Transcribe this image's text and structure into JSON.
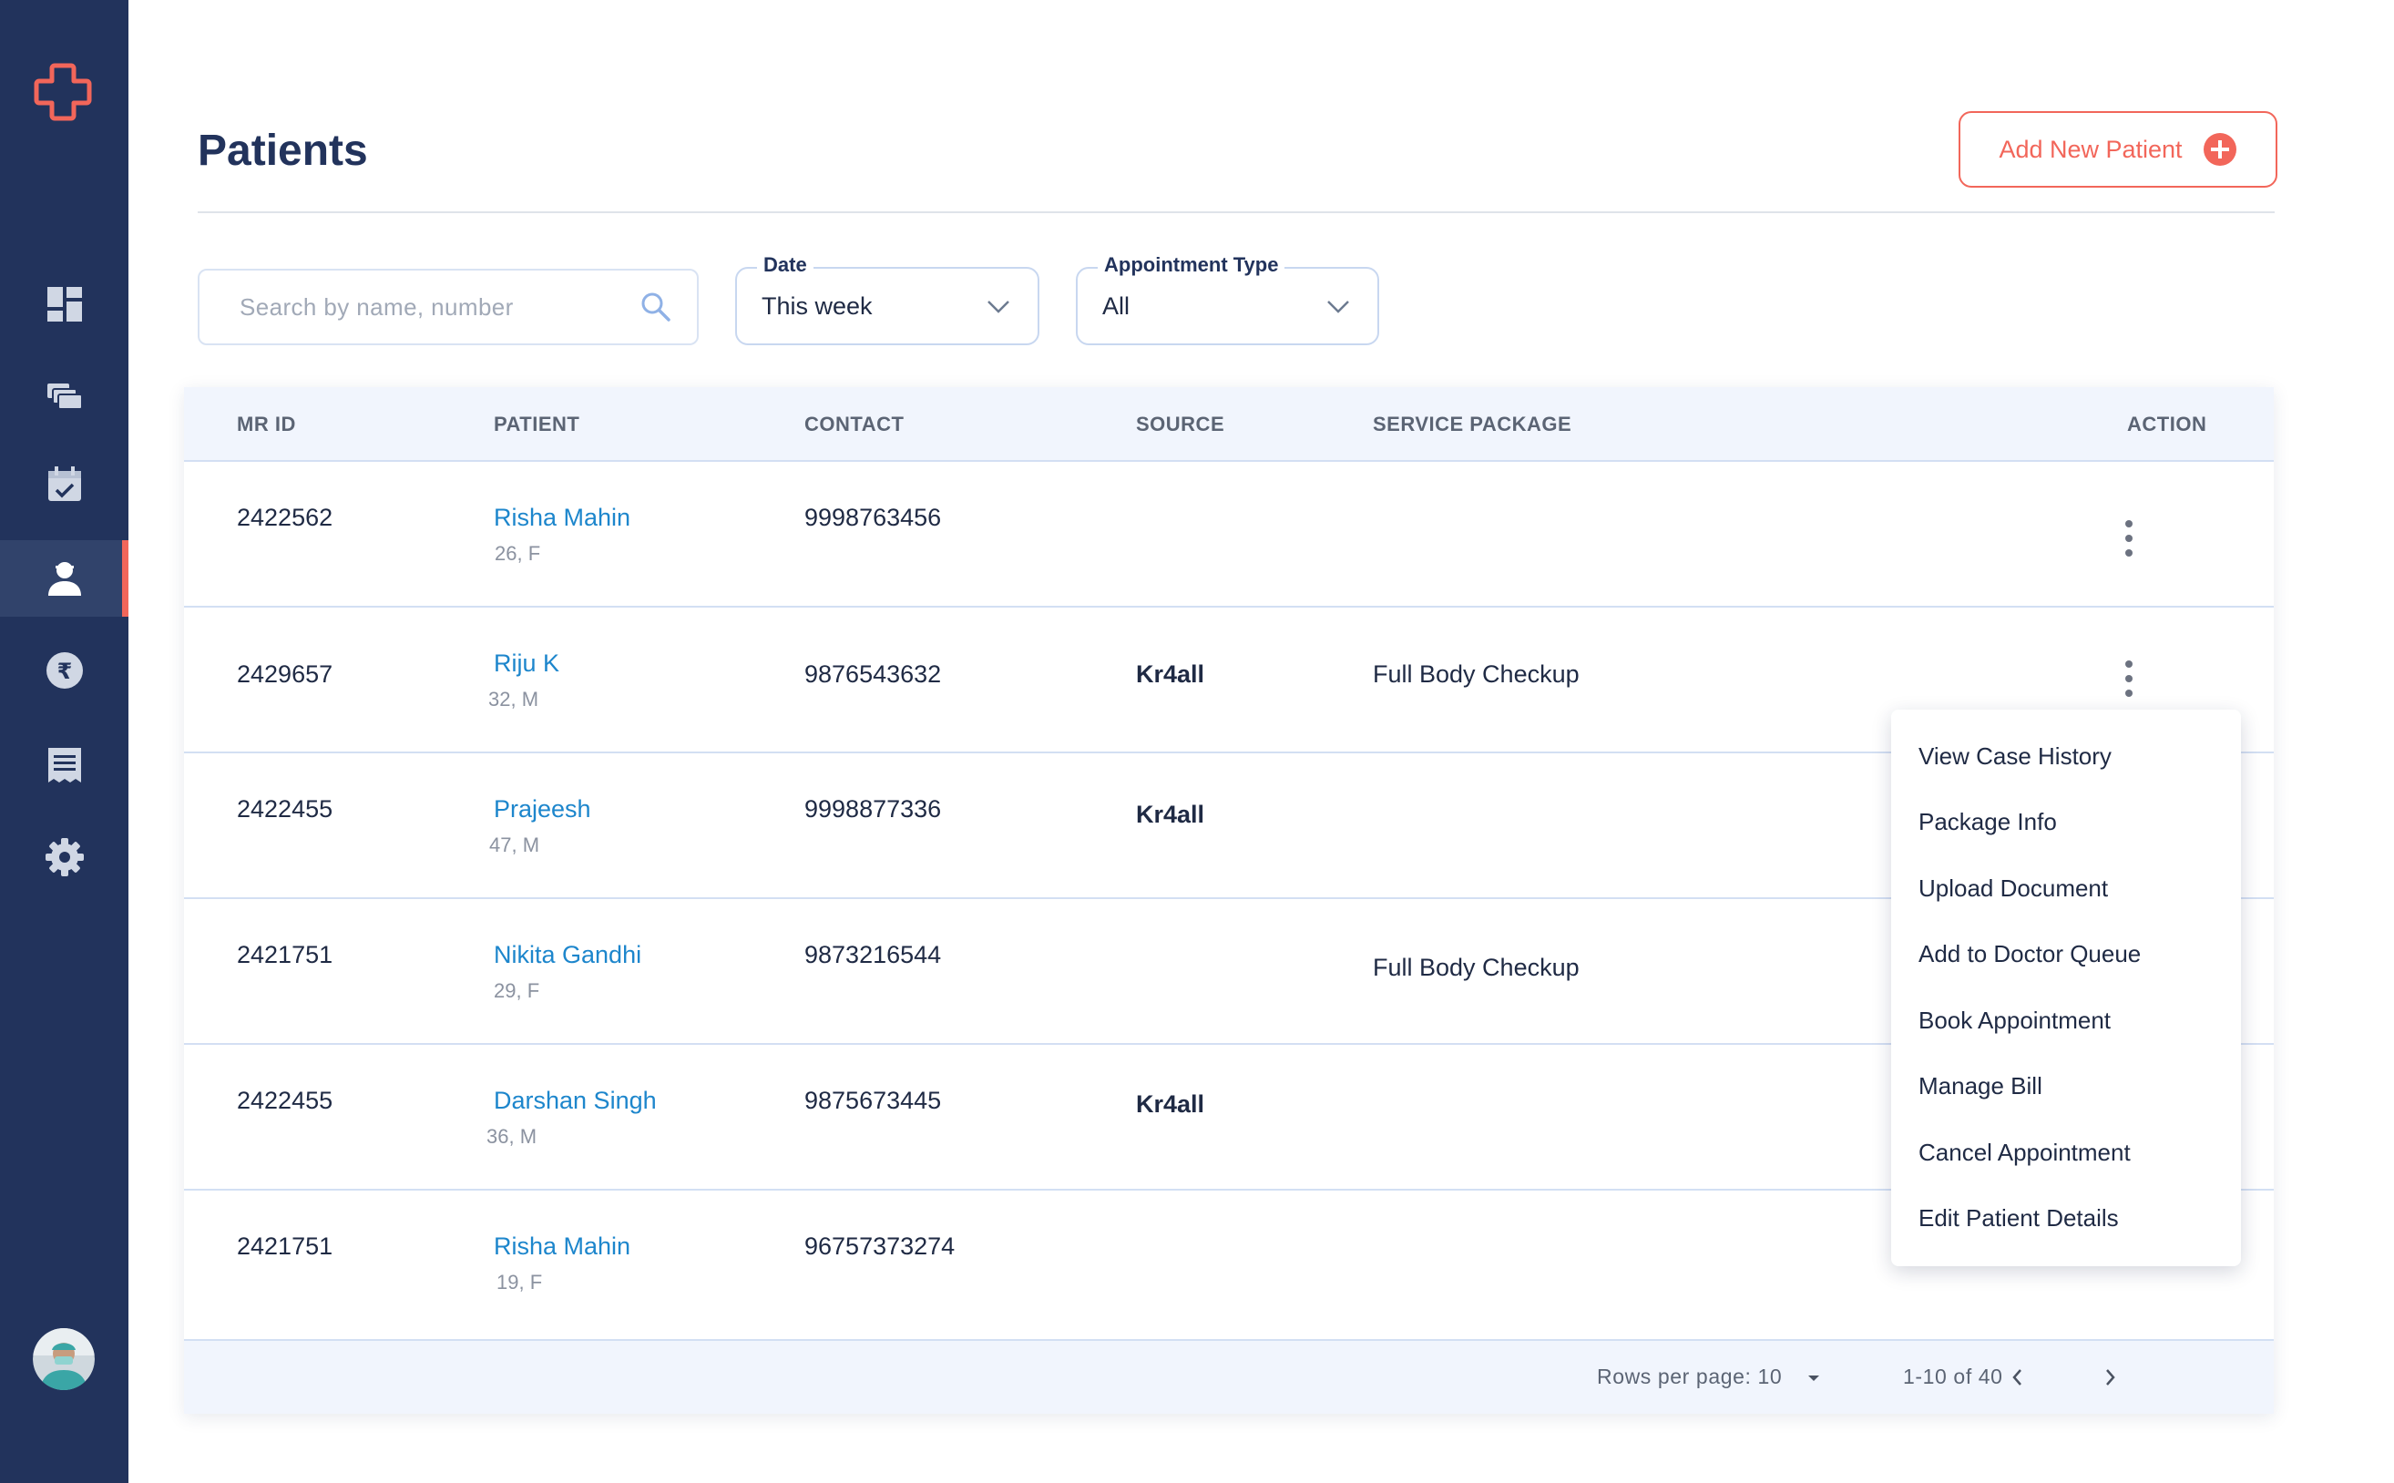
{
  "sidebar": {
    "items": [
      {
        "icon": "dashboard-icon"
      },
      {
        "icon": "patients-cards-icon"
      },
      {
        "icon": "calendar-check-icon"
      },
      {
        "icon": "patient-user-icon",
        "active": true
      },
      {
        "icon": "rupee-icon"
      },
      {
        "icon": "receipt-icon"
      },
      {
        "icon": "settings-gear-icon"
      }
    ],
    "avatar_icon": "doctor-avatar"
  },
  "header": {
    "title": "Patients",
    "add_button_label": "Add New Patient"
  },
  "filters": {
    "search_placeholder": "Search by name, number",
    "date_label": "Date",
    "date_value": "This week",
    "appointment_type_label": "Appointment Type",
    "appointment_type_value": "All"
  },
  "table": {
    "columns": [
      "MR ID",
      "PATIENT",
      "CONTACT",
      "SOURCE",
      "SERVICE PACKAGE",
      "ACTION"
    ],
    "rows": [
      {
        "mr_id": "2422562",
        "name": "Risha Mahin",
        "age_sex": "26, F",
        "contact": "9998763456",
        "source": "",
        "package": ""
      },
      {
        "mr_id": "2429657",
        "name": "Riju K",
        "age_sex": "32, M",
        "contact": "9876543632",
        "source": "Kr4all",
        "package": "Full Body Checkup"
      },
      {
        "mr_id": "2422455",
        "name": "Prajeesh",
        "age_sex": "47, M",
        "contact": "9998877336",
        "source": "Kr4all",
        "package": ""
      },
      {
        "mr_id": "2421751",
        "name": "Nikita Gandhi",
        "age_sex": "29, F",
        "contact": "9873216544",
        "source": "",
        "package": "Full Body Checkup"
      },
      {
        "mr_id": "2422455",
        "name": "Darshan Singh",
        "age_sex": "36, M",
        "contact": "9875673445",
        "source": "Kr4all",
        "package": ""
      },
      {
        "mr_id": "2421751",
        "name": "Risha Mahin",
        "age_sex": "19, F",
        "contact": "96757373274",
        "source": "",
        "package": ""
      }
    ],
    "footer": {
      "rows_per_page": "Rows per page: 10",
      "range": "1-10 of 40"
    }
  },
  "action_menu": {
    "items": [
      "View Case History",
      "Package Info",
      "Upload Document",
      "Add to Doctor Queue",
      "Book Appointment",
      "Manage Bill",
      "Cancel Appointment",
      "Edit Patient Details"
    ]
  },
  "colors": {
    "sidebar_bg": "#22335c",
    "accent": "#f2665a",
    "link": "#1d86cc",
    "title": "#22335c"
  }
}
